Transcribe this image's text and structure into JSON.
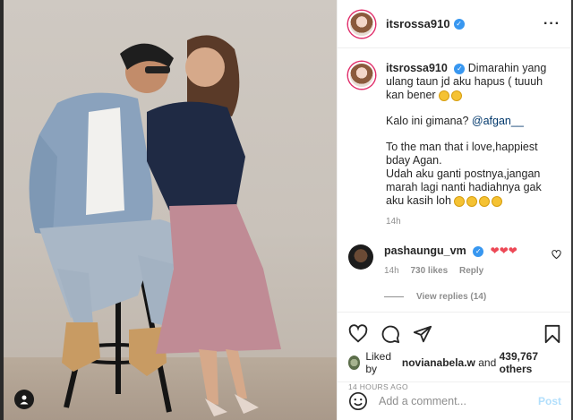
{
  "post": {
    "username": "itsrossa910",
    "caption_user": "itsrossa910",
    "caption_lines": [
      "Dimarahin yang ulang taun jd aku hapus ( tuuuh kan bener",
      "Kalo ini gimana?",
      "To the man that i love,happiest bday Agan.",
      "Udah aku ganti postnya,jangan marah lagi nanti hadiahnya gak aku kasih loh"
    ],
    "mention": "@afgan__",
    "caption_time": "14h"
  },
  "comment": {
    "username": "pashaungu_vm",
    "hearts": "❤❤❤",
    "time": "14h",
    "likes": "730 likes",
    "reply": "Reply",
    "view_replies": "View replies (14)"
  },
  "likes": {
    "prefix": "Liked by",
    "user": "novianabela.w",
    "connector": "and",
    "count": "439,767 others"
  },
  "timestamp": "14 HOURS AGO",
  "add_comment": {
    "placeholder": "Add a comment...",
    "post_label": "Post"
  },
  "icons": {
    "more": "more-icon",
    "like": "heart-icon",
    "comment": "comment-icon",
    "share": "share-icon",
    "save": "bookmark-icon",
    "emoji": "emoji-icon",
    "user_tag": "user-tag-icon"
  },
  "colors": {
    "verified": "#3897f0",
    "heart": "#ed4956",
    "post_button": "#b2dffc"
  }
}
